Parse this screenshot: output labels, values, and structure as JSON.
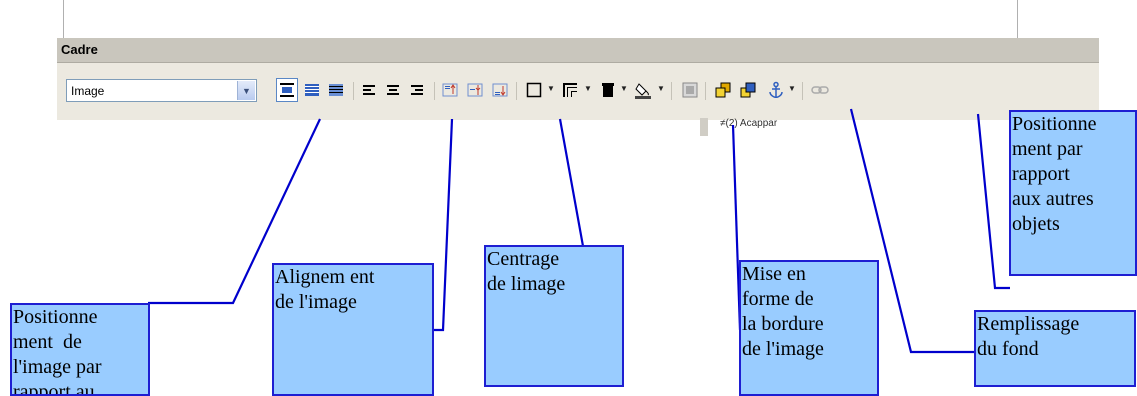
{
  "toolbar": {
    "title": "Cadre",
    "frame_style": {
      "selected": "Image"
    },
    "buttons": [
      {
        "name": "wrap-none-button",
        "pressed": true
      },
      {
        "name": "wrap-through-button",
        "pressed": false
      },
      {
        "name": "wrap-background-button",
        "pressed": false
      },
      {
        "name": "align-left-button",
        "pressed": false
      },
      {
        "name": "align-center-button",
        "pressed": false
      },
      {
        "name": "align-right-button",
        "pressed": false
      },
      {
        "name": "align-top-button",
        "pressed": false
      },
      {
        "name": "align-middle-button",
        "pressed": false
      },
      {
        "name": "align-bottom-button",
        "pressed": false
      },
      {
        "name": "borders-button",
        "pressed": false
      },
      {
        "name": "border-style-button",
        "pressed": false
      },
      {
        "name": "border-color-button",
        "pressed": false
      },
      {
        "name": "background-color-button",
        "pressed": false
      },
      {
        "name": "frame-properties-button",
        "pressed": false
      },
      {
        "name": "bring-to-front-button",
        "pressed": false
      },
      {
        "name": "send-to-back-button",
        "pressed": false
      },
      {
        "name": "anchor-button",
        "pressed": false
      },
      {
        "name": "link-button",
        "pressed": false
      }
    ]
  },
  "background_fragment": "≠(2) Acappar",
  "callouts": {
    "text_position": "Positionne\nment  de\nl'image par\nrapport au\ntexte",
    "alignment": "Alignem ent\nde l'image",
    "centering": "Centrage\nde limage",
    "border_format": "Mise en\nforme de\nla bordure\nde l'image",
    "background_fill": "Remplissage\ndu fond",
    "object_position": "Positionne\nment par\nrapport\naux autres\nobjets"
  },
  "colors": {
    "callout_fill": "#99ccff",
    "callout_border": "#1e1ed2",
    "connector": "#0000cc",
    "toolbar_bg": "#ece9e0",
    "titlebar_bg": "#c9c6bd"
  }
}
